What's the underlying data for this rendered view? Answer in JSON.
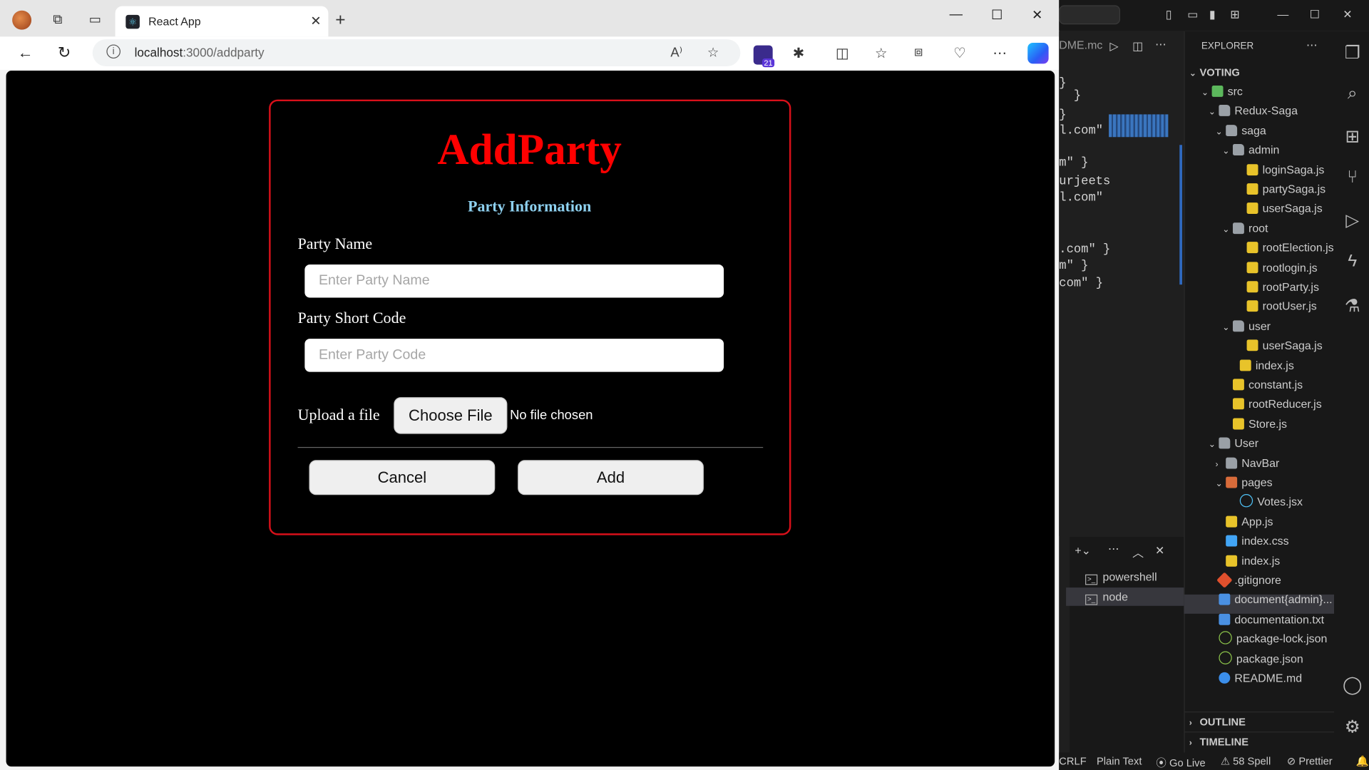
{
  "browser": {
    "tab_title": "React App",
    "url_host": "localhost",
    "url_path": ":3000/addparty",
    "extension_badge": "21"
  },
  "form": {
    "title": "AddParty",
    "subtitle": "Party Information",
    "party_name_label": "Party Name",
    "party_name_placeholder": "Enter Party Name",
    "party_code_label": "Party Short Code",
    "party_code_placeholder": "Enter Party Code",
    "upload_label": "Upload a file",
    "choose_file_label": "Choose File",
    "no_file_text": "No file chosen",
    "cancel_label": "Cancel",
    "add_label": "Add",
    "title_color": "#ff0000",
    "subtitle_color": "#8ed1f0",
    "border_color": "#d8101a"
  },
  "vscode": {
    "editor_tab": "DME.mc",
    "code_lines": [
      "}",
      "  }",
      "}",
      "l.com\"",
      "",
      "m\" }",
      "urjeets",
      "l.com\"",
      "",
      "",
      ".com\" }",
      "m\" }",
      "com\" }"
    ],
    "explorer_title": "EXPLORER",
    "project": "VOTING",
    "tree": [
      {
        "label": "src",
        "icon": "gfolder"
      },
      {
        "label": "Redux-Saga",
        "icon": "folder"
      },
      {
        "label": "saga",
        "icon": "folder"
      },
      {
        "label": "admin",
        "icon": "folder"
      },
      {
        "label": "loginSaga.js",
        "icon": "js"
      },
      {
        "label": "partySaga.js",
        "icon": "js"
      },
      {
        "label": "userSaga.js",
        "icon": "js"
      },
      {
        "label": "root",
        "icon": "folder"
      },
      {
        "label": "rootElection.js",
        "icon": "js"
      },
      {
        "label": "rootlogin.js",
        "icon": "js"
      },
      {
        "label": "rootParty.js",
        "icon": "js"
      },
      {
        "label": "rootUser.js",
        "icon": "js"
      },
      {
        "label": "user",
        "icon": "folder"
      },
      {
        "label": "userSaga.js",
        "icon": "js"
      },
      {
        "label": "index.js",
        "icon": "js"
      },
      {
        "label": "constant.js",
        "icon": "js"
      },
      {
        "label": "rootReducer.js",
        "icon": "js"
      },
      {
        "label": "Store.js",
        "icon": "js"
      },
      {
        "label": "User",
        "icon": "folder"
      },
      {
        "label": "NavBar",
        "icon": "folder"
      },
      {
        "label": "pages",
        "icon": "ofolder"
      },
      {
        "label": "Votes.jsx",
        "icon": "react"
      },
      {
        "label": "App.js",
        "icon": "js"
      },
      {
        "label": "index.css",
        "icon": "css"
      },
      {
        "label": "index.js",
        "icon": "js"
      },
      {
        "label": ".gitignore",
        "icon": "git"
      },
      {
        "label": "document{admin}...",
        "icon": "doc"
      },
      {
        "label": "documentation.txt",
        "icon": "doc"
      },
      {
        "label": "package-lock.json",
        "icon": "json"
      },
      {
        "label": "package.json",
        "icon": "json"
      },
      {
        "label": "README.md",
        "icon": "info"
      }
    ],
    "outline_label": "OUTLINE",
    "timeline_label": "TIMELINE",
    "terminals": [
      "powershell",
      "node"
    ],
    "status": {
      "eol": "CRLF",
      "language": "Plain Text",
      "go_live": "Go Live",
      "spell": "58 Spell",
      "prettier": "Prettier"
    }
  }
}
